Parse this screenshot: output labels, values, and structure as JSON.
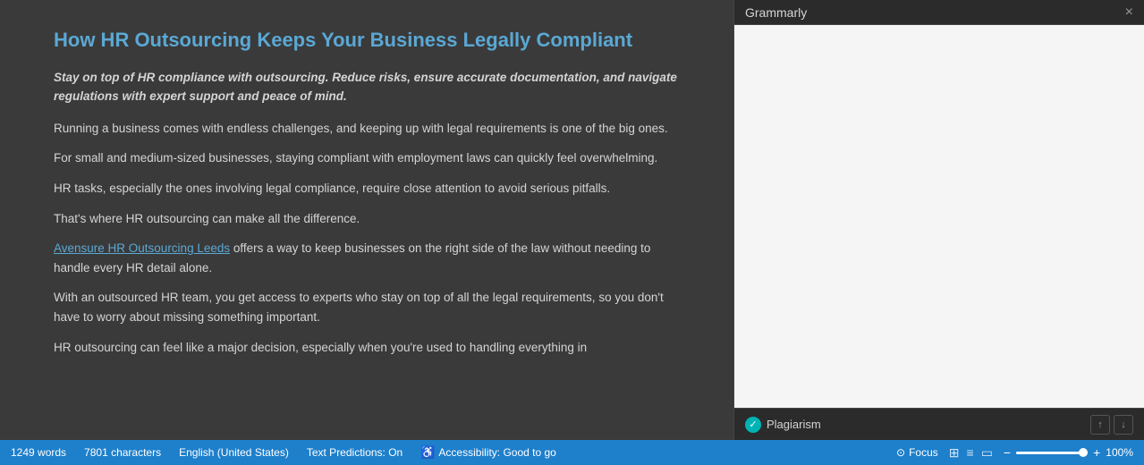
{
  "document": {
    "title": "How HR Outsourcing Keeps Your Business Legally Compliant",
    "subtitle": "Stay on top of HR compliance with outsourcing. Reduce risks, ensure accurate documentation, and navigate regulations with expert support and peace of mind.",
    "paragraphs": [
      "Running a business comes with endless challenges, and keeping up with legal requirements is one of the big ones.",
      "For small and medium-sized businesses, staying compliant with employment laws can quickly feel overwhelming.",
      "HR tasks, especially the ones involving legal compliance, require close attention to avoid serious pitfalls.",
      "That's where HR outsourcing can make all the difference.",
      "",
      "offers a way to keep businesses on the right side of the law without needing to handle every HR detail alone.",
      "With an outsourced HR team, you get access to experts who stay on top of all the legal requirements, so you don't have to worry about missing something important.",
      "HR outsourcing can feel like a major decision, especially when you're used to handling everything in"
    ],
    "link_text": "Avensure HR Outsourcing Leeds",
    "link_paragraph_index": 5
  },
  "grammarly": {
    "title": "Grammarly",
    "close_label": "×",
    "plagiarism_label": "Plagiarism",
    "nav_up": "↑",
    "nav_down": "↓"
  },
  "status_bar": {
    "words": "1249 words",
    "characters": "7801 characters",
    "language": "English (United States)",
    "text_predictions": "Text Predictions: On",
    "accessibility": "Accessibility: Good to go",
    "focus": "Focus",
    "zoom_percent": "100%",
    "zoom_minus": "−",
    "zoom_plus": "+"
  }
}
